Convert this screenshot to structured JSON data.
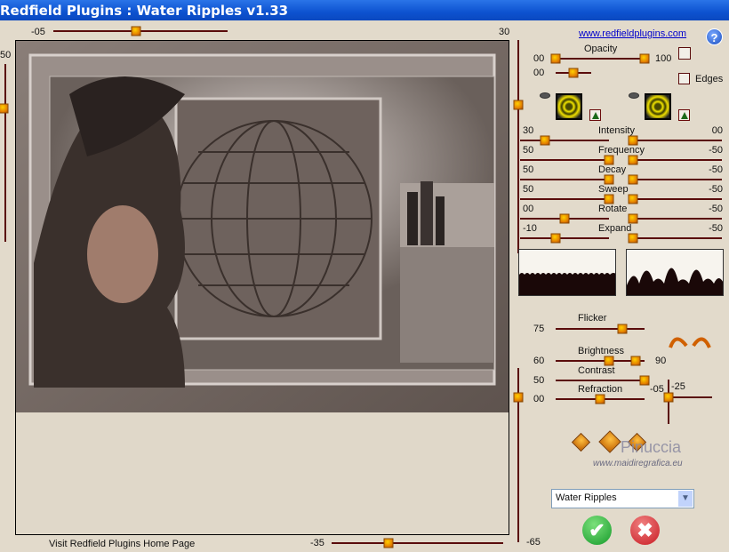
{
  "window": {
    "title": "Redfield Plugins : Water Ripples v1.33"
  },
  "preview": {
    "top_value": "-05",
    "top_right_value": "30",
    "left_value": "50",
    "bottom_value": "-35",
    "right_bottom_value": "-65",
    "home_link": "Visit Redfield Plugins Home Page"
  },
  "panel": {
    "site_link": "www.redfieldplugins.com",
    "opacity": {
      "label": "Opacity",
      "min": "00",
      "max": "100",
      "second": "00"
    },
    "edges_label": "Edges",
    "sliders": [
      {
        "label": "Intensity",
        "left": "30",
        "right": "00"
      },
      {
        "label": "Frequency",
        "left": "50",
        "right": "-50"
      },
      {
        "label": "Decay",
        "left": "50",
        "right": "-50"
      },
      {
        "label": "Sweep",
        "left": "50",
        "right": "-50"
      },
      {
        "label": "Rotate",
        "left": "00",
        "right": "-50"
      },
      {
        "label": "Expand",
        "left": "-10",
        "right": "-50"
      }
    ],
    "flicker": {
      "label": "Flicker",
      "value": "75"
    },
    "brightness": {
      "label": "Brightness",
      "value": "60",
      "max": "90"
    },
    "contrast": {
      "label": "Contrast",
      "value": "50"
    },
    "refraction": {
      "label": "Refraction",
      "value": "00"
    },
    "cross": {
      "x": "-05",
      "y": "-25"
    },
    "watermark": {
      "name": "Pinuccia",
      "url": "www.maidiregrafica.eu"
    },
    "preset": "Water Ripples"
  }
}
